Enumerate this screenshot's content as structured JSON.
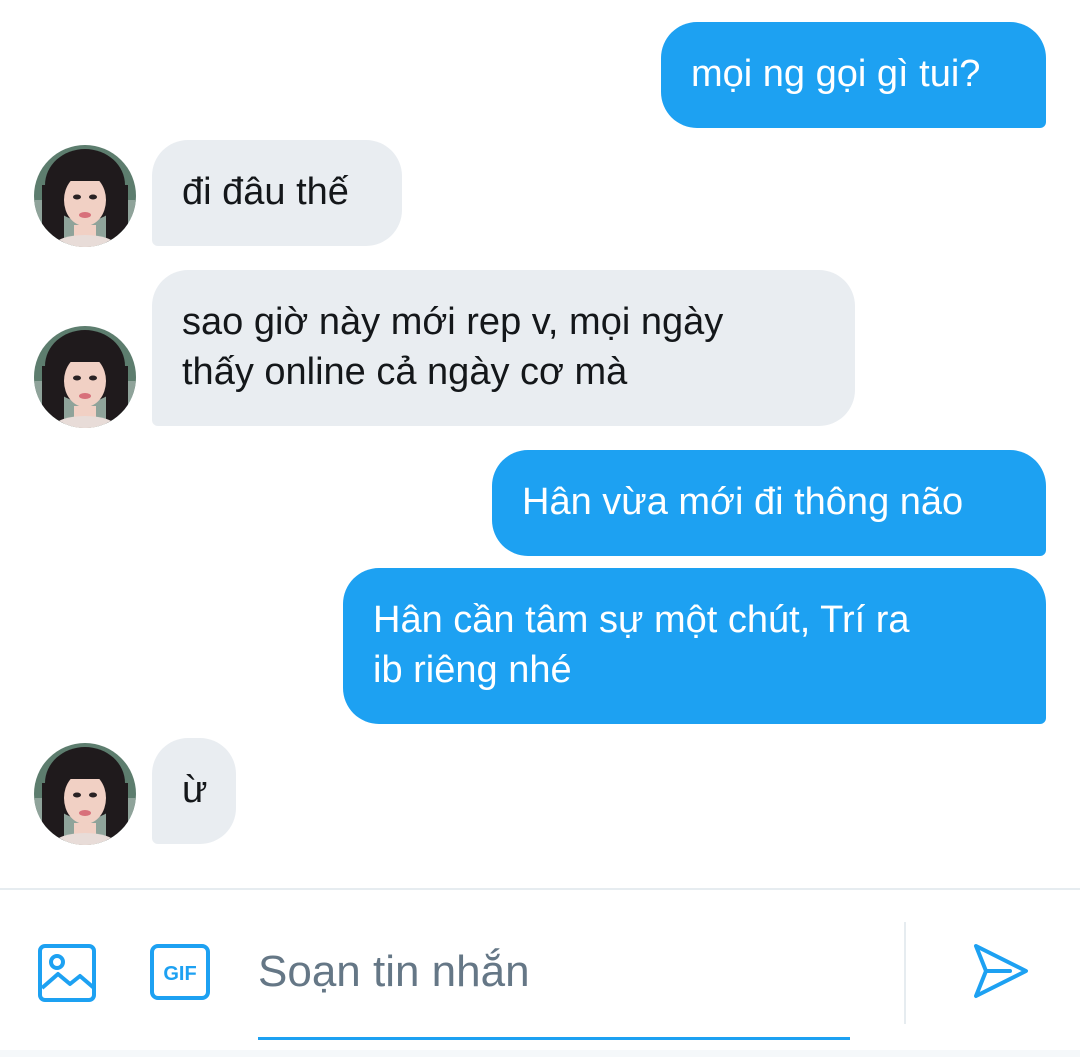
{
  "conversation": {
    "messages": [
      {
        "direction": "out",
        "text": "mọi ng gọi gì tui?"
      },
      {
        "direction": "in",
        "text": "đi đâu thế"
      },
      {
        "direction": "in",
        "text": "sao giờ này mới rep v, mọi ngày\nthấy online cả ngày cơ mà"
      },
      {
        "direction": "out",
        "text": "Hân vừa mới đi thông não"
      },
      {
        "direction": "out",
        "text": "Hân cần tâm sự một chút, Trí ra\nib riêng nhé"
      },
      {
        "direction": "in",
        "text": "ừ"
      }
    ]
  },
  "composer": {
    "placeholder": "Soạn tin nhắn",
    "value": "",
    "media_icon": "image-icon",
    "gif_label": "GIF",
    "send_icon": "send-icon"
  },
  "colors": {
    "outgoing_bubble": "#1da1f2",
    "incoming_bubble": "#e9edf1",
    "accent": "#1da1f2"
  }
}
